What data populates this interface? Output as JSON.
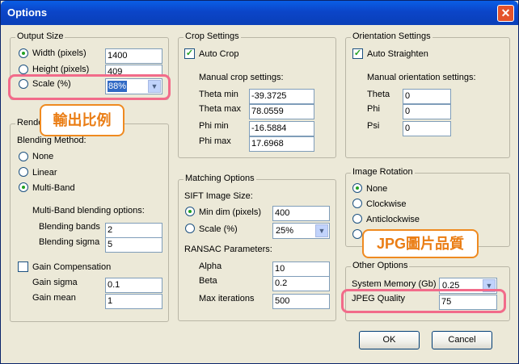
{
  "window": {
    "title": "Options",
    "close_glyph": "✕"
  },
  "output_size": {
    "title": "Output Size",
    "width_label": "Width (pixels)",
    "width_value": "1400",
    "height_label": "Height (pixels)",
    "height_value": "409",
    "scale_label": "Scale (%)",
    "scale_value": "88%"
  },
  "render": {
    "title": "Rende",
    "blending_method_label": "Blending Method:",
    "none_label": "None",
    "linear_label": "Linear",
    "multiband_label": "Multi-Band",
    "multiband_options_label": "Multi-Band blending options:",
    "blending_bands_label": "Blending bands",
    "blending_bands_value": "2",
    "blending_sigma_label": "Blending sigma",
    "blending_sigma_value": "5",
    "gain_comp_label": "Gain Compensation",
    "gain_sigma_label": "Gain sigma",
    "gain_sigma_value": "0.1",
    "gain_mean_label": "Gain mean",
    "gain_mean_value": "1"
  },
  "crop": {
    "title": "Crop Settings",
    "auto_crop_label": "Auto Crop",
    "manual_label": "Manual crop settings:",
    "theta_min_label": "Theta min",
    "theta_min_value": "-39.3725",
    "theta_max_label": "Theta max",
    "theta_max_value": "78.0559",
    "phi_min_label": "Phi min",
    "phi_min_value": "-16.5884",
    "phi_max_label": "Phi max",
    "phi_max_value": "17.6968"
  },
  "matching": {
    "title": "Matching Options",
    "sift_label": "SIFT Image Size:",
    "min_dim_label": "Min dim (pixels)",
    "min_dim_value": "400",
    "scale_label": "Scale (%)",
    "scale_value": "25%",
    "ransac_label": "RANSAC Parameters:",
    "alpha_label": "Alpha",
    "alpha_value": "10",
    "beta_label": "Beta",
    "beta_value": "0.2",
    "max_iter_label": "Max iterations",
    "max_iter_value": "500"
  },
  "orientation": {
    "title": "Orientation Settings",
    "auto_straighten_label": "Auto Straighten",
    "manual_label": "Manual orientation settings:",
    "theta_label": "Theta",
    "theta_value": "0",
    "phi_label": "Phi",
    "phi_value": "0",
    "psi_label": "Psi",
    "psi_value": "0"
  },
  "rotation": {
    "title": "Image Rotation",
    "none_label": "None",
    "clockwise_label": "Clockwise",
    "anticlockwise_label": "Anticlockwise"
  },
  "other": {
    "title": "Other Options",
    "memory_label": "System Memory (Gb)",
    "memory_value": "0.25",
    "jpeg_label": "JPEG Quality",
    "jpeg_value": "75"
  },
  "buttons": {
    "ok": "OK",
    "cancel": "Cancel"
  },
  "annotations": {
    "output_scale": "輸出比例",
    "jpg_quality": "JPG圖片品質"
  },
  "colors": {
    "highlight": "#f26b8a",
    "callout": "#ef8a20",
    "titlebar": "#0b45c8",
    "selection": "#316ac5"
  }
}
